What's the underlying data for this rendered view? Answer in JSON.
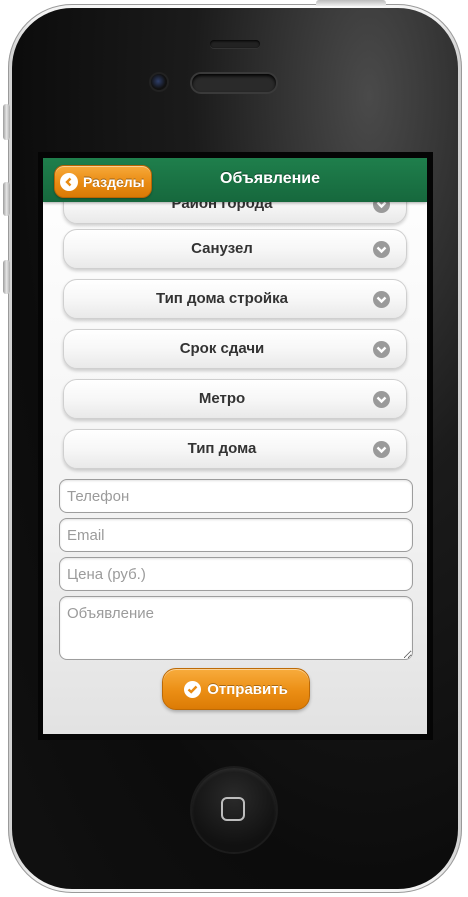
{
  "header": {
    "back_label": "Разделы",
    "title": "Объявление"
  },
  "form": {
    "selects": [
      {
        "label": "Район города"
      },
      {
        "label": "Санузел"
      },
      {
        "label": "Тип дома стройка"
      },
      {
        "label": "Срок сдачи"
      },
      {
        "label": "Метро"
      },
      {
        "label": "Тип дома"
      }
    ],
    "phone_placeholder": "Телефон",
    "email_placeholder": "Email",
    "price_placeholder": "Цена (руб.)",
    "ad_placeholder": "Объявление",
    "submit_label": "Отправить"
  },
  "colors": {
    "header_bg": "#1a744a",
    "accent": "#ed8f14"
  },
  "icons": {
    "back": "chevron-left-icon",
    "select": "chevron-down-icon",
    "submit": "check-icon"
  }
}
